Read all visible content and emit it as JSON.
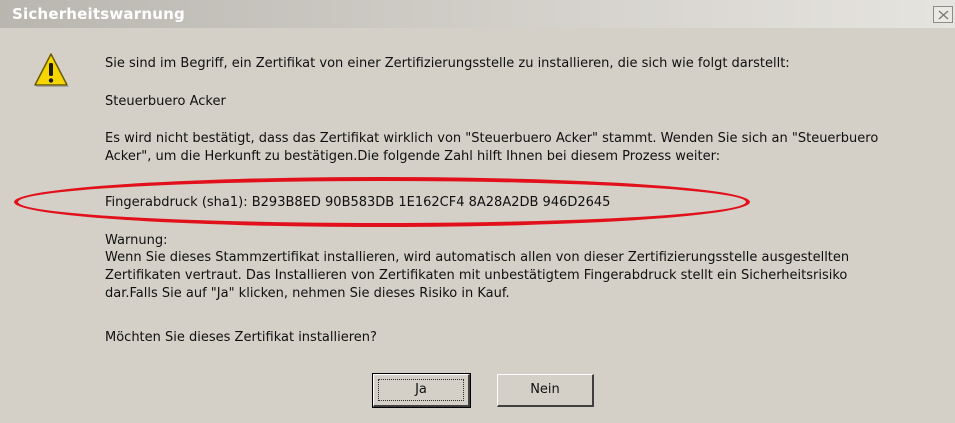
{
  "dialog": {
    "title": "Sicherheitswarnung",
    "icon": "warning-icon",
    "message": {
      "intro": "Sie sind im Begriff, ein Zertifikat von einer Zertifizierungsstelle zu installieren, die sich wie folgt darstellt:",
      "issuer": "Steuerbuero Acker",
      "notice_line1": "Es wird nicht bestätigt, dass das Zertifikat wirklich von \"Steuerbuero Acker\" stammt. Wenden Sie sich an \"Steuerbuero",
      "notice_line2": "Acker\", um die Herkunft zu bestätigen.Die folgende Zahl hilft Ihnen bei diesem Prozess weiter:",
      "fingerprint": "Fingerabdruck (sha1): B293B8ED 90B583DB 1E162CF4 8A28A2DB 946D2645",
      "warning_heading": "Warnung:",
      "warning_line1": "Wenn Sie dieses Stammzertifikat installieren, wird automatisch allen von dieser Zertifizierungsstelle ausgestellten",
      "warning_line2": "Zertifikaten vertraut. Das Installieren von Zertifikaten mit unbestätigtem Fingerabdruck stellt ein Sicherheitsrisiko",
      "warning_line3": "dar.Falls Sie auf \"Ja\" klicken, nehmen Sie dieses Risiko in Kauf.",
      "question": "Möchten Sie dieses Zertifikat installieren?"
    },
    "buttons": {
      "yes": "Ja",
      "no": "Nein"
    },
    "colors": {
      "highlight": "#e2101a",
      "dialog_background": "#d4d0c8"
    }
  }
}
